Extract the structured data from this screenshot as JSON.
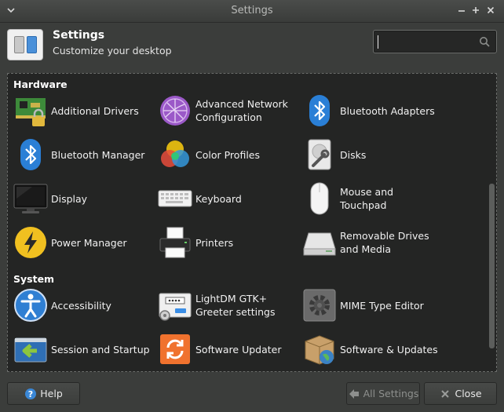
{
  "window": {
    "title": "Settings"
  },
  "header": {
    "title": "Settings",
    "subtitle": "Customize your desktop"
  },
  "search": {
    "value": "",
    "placeholder": ""
  },
  "sections": [
    {
      "title": "Hardware",
      "items": [
        {
          "label": "Additional Drivers",
          "icon": "chip-lock-icon"
        },
        {
          "label": "Advanced Network Configuration",
          "icon": "network-globe-icon"
        },
        {
          "label": "Bluetooth Adapters",
          "icon": "bluetooth-icon"
        },
        {
          "label": "Bluetooth Manager",
          "icon": "bluetooth-icon"
        },
        {
          "label": "Color Profiles",
          "icon": "color-circles-icon"
        },
        {
          "label": "Disks",
          "icon": "disk-wrench-icon"
        },
        {
          "label": "Display",
          "icon": "monitor-icon"
        },
        {
          "label": "Keyboard",
          "icon": "keyboard-icon"
        },
        {
          "label": "Mouse and Touchpad",
          "icon": "mouse-icon"
        },
        {
          "label": "Power Manager",
          "icon": "power-bolt-icon"
        },
        {
          "label": "Printers",
          "icon": "printer-icon"
        },
        {
          "label": "Removable Drives and Media",
          "icon": "drive-icon"
        }
      ]
    },
    {
      "title": "System",
      "items": [
        {
          "label": "Accessibility",
          "icon": "accessibility-icon"
        },
        {
          "label": "LightDM GTK+ Greeter settings",
          "icon": "greeter-icon"
        },
        {
          "label": "MIME Type Editor",
          "icon": "gear-icon"
        },
        {
          "label": "Session and Startup",
          "icon": "session-arrow-icon"
        },
        {
          "label": "Software Updater",
          "icon": "refresh-icon"
        },
        {
          "label": "Software & Updates",
          "icon": "package-globe-icon"
        }
      ]
    }
  ],
  "footer": {
    "help": "Help",
    "all_settings": "All Settings",
    "close": "Close"
  },
  "colors": {
    "background": "#3b3d3b",
    "panel": "#242524",
    "bluetooth": "#2a7fd6",
    "power": "#f0c020",
    "updater": "#f0722e"
  }
}
